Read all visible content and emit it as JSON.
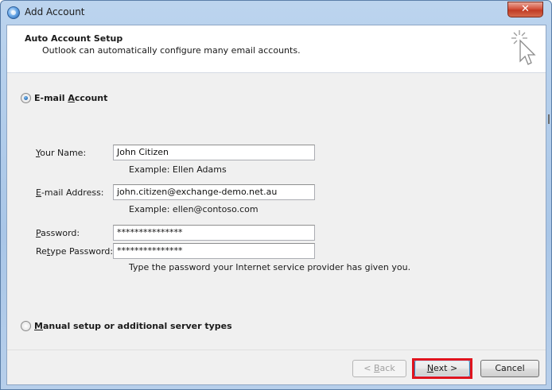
{
  "window": {
    "title": "Add Account",
    "close_label": "✕"
  },
  "header": {
    "title": "Auto Account Setup",
    "subtitle": "Outlook can automatically configure many email accounts."
  },
  "email_account": {
    "option_label_prefix": "E-mail ",
    "option_label_accel": "A",
    "option_label_suffix": "ccount",
    "selected": true,
    "fields": {
      "name": {
        "label_accel": "Y",
        "label_rest": "our Name:",
        "value": "John Citizen",
        "hint": "Example: Ellen Adams"
      },
      "email": {
        "label_accel": "E",
        "label_rest": "-mail Address:",
        "value": "john.citizen@exchange-demo.net.au",
        "hint": "Example: ellen@contoso.com"
      },
      "password": {
        "label_accel": "P",
        "label_rest": "assword:",
        "value": "***************"
      },
      "retype_password": {
        "label_pre": "Re",
        "label_accel": "t",
        "label_rest": "ype Password:",
        "value": "***************",
        "hint": "Type the password your Internet service provider has given you."
      }
    }
  },
  "manual_setup": {
    "label_accel": "M",
    "label_rest": "anual setup or additional server types",
    "selected": false
  },
  "buttons": {
    "back": {
      "pre": "< ",
      "accel": "B",
      "rest": "ack",
      "enabled": false
    },
    "next": {
      "accel": "N",
      "rest": "ext >",
      "enabled": true
    },
    "cancel": {
      "label": "Cancel"
    }
  },
  "colors": {
    "highlight": "#e0141e",
    "title_bar": "#a9c6e7",
    "close_button": "#c03a24"
  }
}
